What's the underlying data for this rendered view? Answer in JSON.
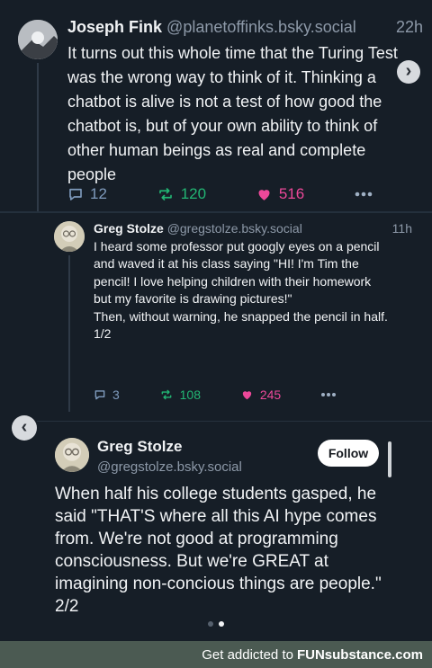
{
  "post1": {
    "author_name": "Joseph Fink",
    "author_handle": "@planetoffinks.bsky.social",
    "time": "22h",
    "text": "It turns out this whole time that the Turing Test was the wrong way to think of it. Thinking a chatbot is alive is not a test of how good the chatbot is, but of your own ability to think of other human beings as real and complete people",
    "reply_count": "12",
    "repost_count": "120",
    "like_count": "516"
  },
  "post2": {
    "author_name": "Greg Stolze",
    "author_handle": "@gregstolze.bsky.social",
    "time": "11h",
    "text": "I heard some professor put googly eyes on a pencil and waved it at his class saying \"HI! I'm Tim the pencil! I love helping children with their homework but my favorite is drawing pictures!\"\nThen, without warning, he snapped the pencil in half.\n1/2",
    "reply_count": "3",
    "repost_count": "108",
    "like_count": "245"
  },
  "post3": {
    "author_name": "Greg Stolze",
    "author_handle": "@gregstolze.bsky.social",
    "follow_label": "Follow",
    "text": "When half his college students gasped, he said \"THAT'S where all this AI hype comes from. We're not good at programming consciousness. But we're GREAT at imagining non-concious things are people.\"\n2/2"
  },
  "footer": {
    "prefix": "Get addicted to",
    "brand": "FUNsubstance.com"
  },
  "icons": {
    "reply": "reply-icon",
    "repost": "repost-icon",
    "like": "heart-icon",
    "more": "more-icon"
  },
  "colors": {
    "background": "#161e27",
    "repost": "#22b573",
    "like": "#ec4899",
    "muted": "#8d99a8"
  }
}
